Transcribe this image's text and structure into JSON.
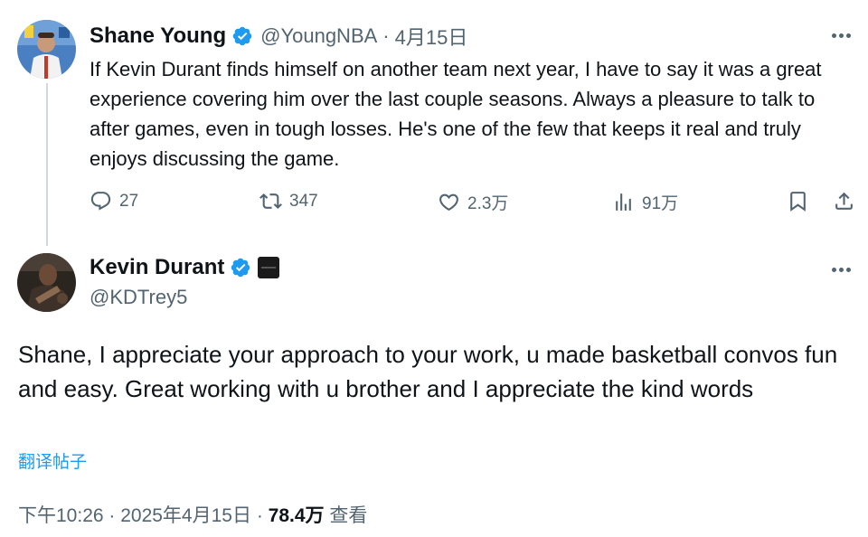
{
  "parent_tweet": {
    "author": {
      "display_name": "Shane Young",
      "handle": "@YoungNBA",
      "verified": true
    },
    "separator": "·",
    "date": "4月15日",
    "text": "If Kevin Durant finds himself on another team next year, I have to say it was a great experience covering him over the last couple seasons. Always a pleasure to talk to after games, even in tough losses. He's one of the few that keeps it real and truly enjoys discussing the game.",
    "actions": {
      "replies": "27",
      "reposts": "347",
      "likes": "2.3万",
      "views": "91万"
    }
  },
  "main_tweet": {
    "author": {
      "display_name": "Kevin Durant",
      "handle": "@KDTrey5",
      "verified": true
    },
    "text": "Shane, I appreciate your approach to your work, u made basketball convos fun and easy. Great working with u brother and I appreciate the kind words",
    "translate_label": "翻译帖子",
    "meta": {
      "time_date": "下午10:26 · 2025年4月15日",
      "separator": "·",
      "views_count": "78.4万",
      "views_label": "查看"
    }
  },
  "colors": {
    "text": "#0f1419",
    "secondary": "#536471",
    "link": "#1d9bf0",
    "verified": "#1d9bf0",
    "thread_line": "#cfd9de"
  }
}
